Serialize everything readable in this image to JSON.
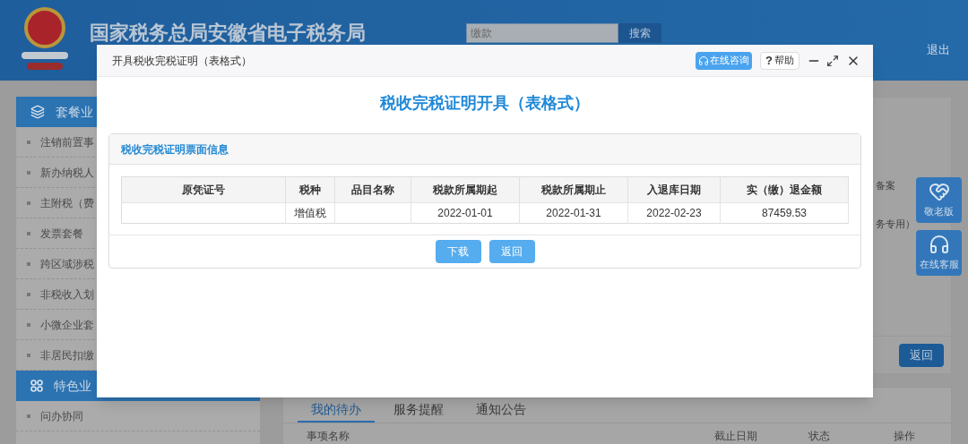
{
  "header": {
    "title": "国家税务总局安徽省电子税务局",
    "search_placeholder": "缴款",
    "search_button": "搜索",
    "logout": "退出"
  },
  "sidebar": {
    "sections": [
      {
        "kind": "layers",
        "title": "套餐业",
        "items": [
          "注销前置事",
          "新办纳税人",
          "主附税（费",
          "发票套餐",
          "跨区域涉税",
          "非税收入划",
          "小微企业套",
          "非居民扣缴"
        ]
      },
      {
        "kind": "clover",
        "title": "特色业",
        "items": [
          "问办协同"
        ]
      }
    ]
  },
  "main": {
    "fragments": [
      "备案",
      "务专用）"
    ],
    "back_button": "返回",
    "tabs": [
      {
        "label": "我的待办",
        "selected": true
      },
      {
        "label": "服务提醒",
        "selected": false
      },
      {
        "label": "通知公告",
        "selected": false
      }
    ],
    "columns": [
      "事项名称",
      "截止日期",
      "状态",
      "操作"
    ]
  },
  "side_buttons": [
    {
      "kind": "elder",
      "label": "敬老版"
    },
    {
      "kind": "service",
      "label": "在线客服"
    }
  ],
  "dialog": {
    "title": "开具税收完税证明（表格式）",
    "consult_button": "在线咨询",
    "help_icon": "?",
    "help_button": "帮助",
    "heading": "税收完税证明开具（表格式）",
    "panel_title": "税收完税证明票面信息",
    "table": {
      "columns": [
        "原凭证号",
        "税种",
        "品目名称",
        "税款所属期起",
        "税款所属期止",
        "入退库日期",
        "实（缴）退金额"
      ],
      "rows": [
        [
          null,
          "增值税",
          null,
          "2022-01-01",
          "2022-01-31",
          "2022-02-23",
          "87459.53"
        ]
      ]
    },
    "buttons": [
      "下载",
      "返回"
    ]
  }
}
